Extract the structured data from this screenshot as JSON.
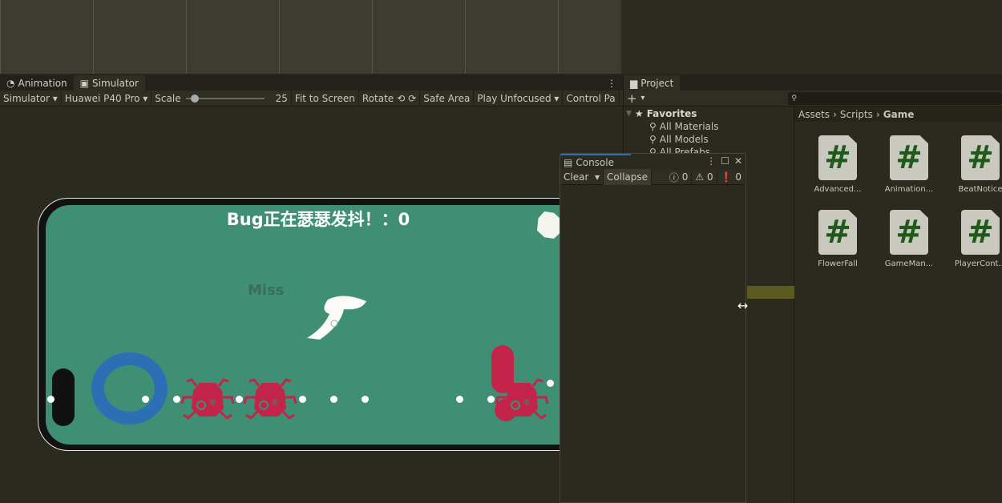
{
  "simulator_panel": {
    "tabs": [
      {
        "label": "Animation",
        "icon": "animation-icon"
      },
      {
        "label": "Simulator",
        "icon": "simulator-icon"
      }
    ],
    "toolbar": {
      "mode": "Simulator",
      "device": "Huawei P40 Pro",
      "scale_label": "Scale",
      "scale_value": "25",
      "scale_fraction": 0.12,
      "fit": "Fit to Screen",
      "rotate": "Rotate",
      "safe_area": "Safe Area",
      "play_mode": "Play Unfocused",
      "control_panel": "Control Pa"
    },
    "game": {
      "score_text": "Bug正在瑟瑟发抖！：0",
      "miss_text": "Miss",
      "bug_color": "#c2244a",
      "ring_color": "#2d6fb5",
      "screen_color": "#3f8f74"
    }
  },
  "project_panel": {
    "tab": "Project",
    "add_label": "+",
    "search_placeholder": "",
    "favorites": {
      "label": "Favorites",
      "items": [
        "All Materials",
        "All Models",
        "All Prefabs"
      ]
    },
    "breadcrumb": [
      "Assets",
      "Scripts",
      "Game"
    ],
    "assets": [
      "Advanced...",
      "Animation...",
      "BeatNotice",
      "FlowerFall",
      "GameMan...",
      "PlayerCont..."
    ]
  },
  "console": {
    "title": "Console",
    "clear": "Clear",
    "collapse": "Collapse",
    "info_count": "0",
    "warning_count": "0",
    "error_count": "0"
  }
}
